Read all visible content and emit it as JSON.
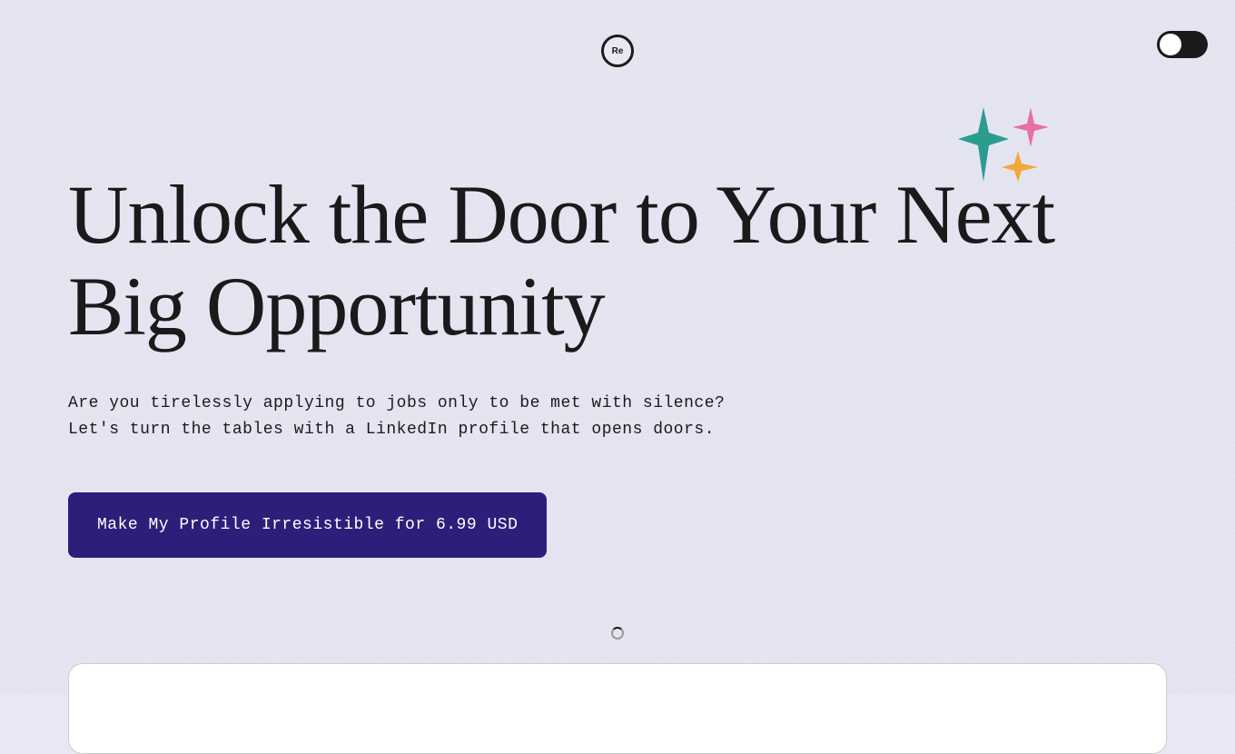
{
  "logo": {
    "text": "Re"
  },
  "toggle": {
    "state": "off"
  },
  "hero": {
    "headline": "Unlock the Door to Your Next Big Opportunity",
    "subhead_line1": "Are you tirelessly applying to jobs only to be met with silence?",
    "subhead_line2": "Let's turn the tables with a LinkedIn profile that opens doors."
  },
  "cta": {
    "label": "Make My Profile Irresistible for 6.99 USD"
  },
  "colors": {
    "background": "#e8e8f5",
    "cta_bg": "#2e1e7a",
    "text_dark": "#1a1a1a",
    "sparkle_teal": "#2a9d8f",
    "sparkle_pink": "#e76fa8",
    "sparkle_orange": "#f2a93b"
  }
}
